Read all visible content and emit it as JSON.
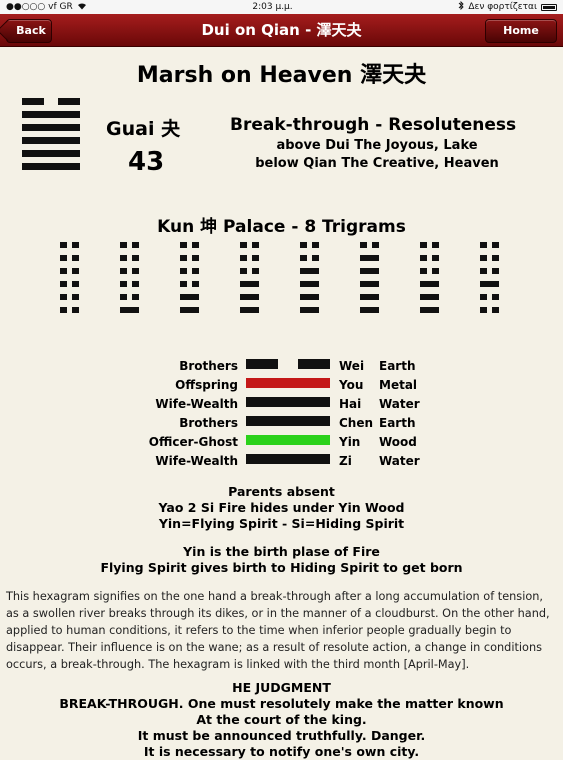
{
  "status": {
    "carrier": "●●○○○ vf GR",
    "time": "2:03 μ.μ.",
    "charging": "Δεν φορτίζεται"
  },
  "nav": {
    "back_label": "Back",
    "title": "Dui on Qian - 澤天夬",
    "home_label": "Home",
    "accent": "#8b1010"
  },
  "hexagram": {
    "title": "Marsh on Heaven 澤天夬",
    "name": "Guai 夬",
    "number": "43",
    "meaning": "Break-through - Resoluteness",
    "desc_line1": "above Dui The Joyous, Lake",
    "desc_line2": "below Qian The Creative, Heaven",
    "lines_top_to_bottom": [
      "yin",
      "yang",
      "yang",
      "yang",
      "yang",
      "yang"
    ]
  },
  "palace": {
    "title": "Kun 坤 Palace - 8 Trigrams",
    "hexagrams": [
      [
        "yin",
        "yin",
        "yin",
        "yin",
        "yin",
        "yin"
      ],
      [
        "yin",
        "yin",
        "yin",
        "yin",
        "yin",
        "yang"
      ],
      [
        "yin",
        "yin",
        "yin",
        "yin",
        "yang",
        "yang"
      ],
      [
        "yin",
        "yin",
        "yin",
        "yang",
        "yang",
        "yang"
      ],
      [
        "yin",
        "yin",
        "yang",
        "yang",
        "yang",
        "yang"
      ],
      [
        "yin",
        "yang",
        "yang",
        "yang",
        "yang",
        "yang"
      ],
      [
        "yin",
        "yin",
        "yin",
        "yang",
        "yang",
        "yang"
      ],
      [
        "yin",
        "yin",
        "yin",
        "yang",
        "yin",
        "yin"
      ]
    ]
  },
  "lines": [
    {
      "relation": "Brothers",
      "type": "yin",
      "color": "#111111",
      "spirit": "Wei",
      "element": "Earth"
    },
    {
      "relation": "Offspring",
      "type": "yang",
      "color": "#c41818",
      "spirit": "You",
      "element": "Metal"
    },
    {
      "relation": "Wife-Wealth",
      "type": "yang",
      "color": "#111111",
      "spirit": "Hai",
      "element": "Water"
    },
    {
      "relation": "Brothers",
      "type": "yang",
      "color": "#111111",
      "spirit": "Chen",
      "element": "Earth"
    },
    {
      "relation": "Officer-Ghost",
      "type": "yang",
      "color": "#2bd21b",
      "spirit": "Yin",
      "element": "Wood"
    },
    {
      "relation": "Wife-Wealth",
      "type": "yang",
      "color": "#111111",
      "spirit": "Zi",
      "element": "Water"
    }
  ],
  "notes": {
    "parents": "Parents absent",
    "hides": "Yao 2 Si Fire hides under Yin Wood",
    "legend": "Yin=Flying Spirit - Si=Hiding Spirit",
    "birth1": "Yin is the birth plase of Fire",
    "birth2": "Flying Spirit gives birth to Hiding Spirit to get born"
  },
  "paragraph": "This hexagram signifies on the one hand a break-through after a long accumulation of tension, as a swollen river breaks through its dikes, or in the manner of a cloudburst. On the other hand, applied to human conditions, it refers to the time when inferior people gradually begin to disappear. Their influence is on the wane; as a result of resolute action, a change in conditions occurs, a break-through. The hexagram is linked with the third month [April-May].",
  "judgment": {
    "heading": "HE JUDGMENT",
    "l1": "BREAK-THROUGH. One must resolutely make the matter known",
    "l2": "At the court of the king.",
    "l3": "It must be announced truthfully. Danger.",
    "l4": "It is necessary to notify one's own city."
  }
}
